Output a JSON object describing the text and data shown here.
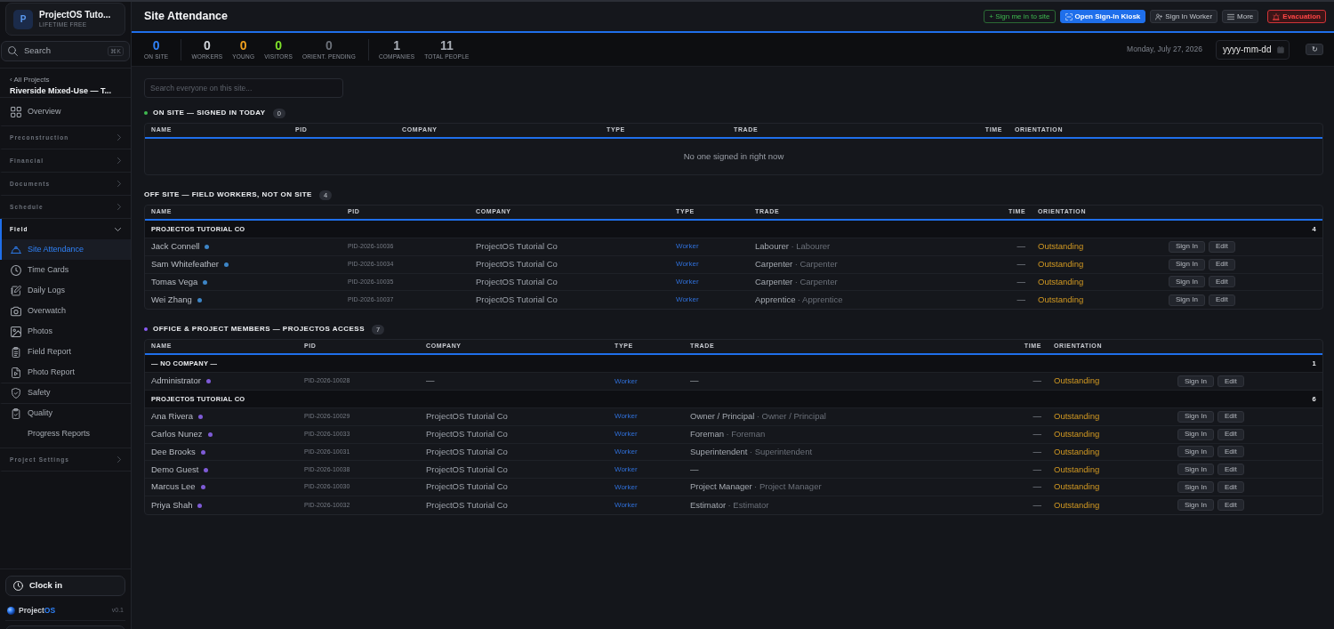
{
  "sidebar": {
    "workspace": {
      "initial": "P",
      "name": "ProjectOS Tuto...",
      "plan": "LIFETIME FREE"
    },
    "search": {
      "label": "Search",
      "shortcut": "⌘K"
    },
    "back_link": "‹ All Projects",
    "project": "Riverside Mixed-Use — T...",
    "nav": [
      {
        "kind": "link",
        "label": "Overview",
        "selected": false
      },
      {
        "kind": "section",
        "label": "Preconstruction",
        "expanded": false
      },
      {
        "kind": "section",
        "label": "Financial",
        "expanded": false
      },
      {
        "kind": "section",
        "label": "Documents",
        "expanded": false
      },
      {
        "kind": "section",
        "label": "Schedule",
        "expanded": false
      },
      {
        "kind": "section",
        "label": "Field",
        "expanded": true,
        "children": [
          {
            "label": "Site Attendance",
            "selected": true,
            "divider_above": false
          },
          {
            "label": "Time Cards",
            "selected": false,
            "divider_above": false
          },
          {
            "label": "Daily Logs",
            "selected": false,
            "divider_above": false
          },
          {
            "label": "Overwatch",
            "selected": false,
            "divider_above": false
          },
          {
            "label": "Photos",
            "selected": false,
            "divider_above": false
          },
          {
            "label": "Field Report",
            "selected": false,
            "divider_above": false
          },
          {
            "label": "Photo Report",
            "selected": false,
            "divider_above": false
          },
          {
            "label": "Safety",
            "selected": false,
            "divider_above": true
          },
          {
            "label": "Quality",
            "selected": false,
            "divider_above": true
          },
          {
            "label": "Progress Reports",
            "selected": false,
            "divider_above": false
          }
        ]
      },
      {
        "kind": "section",
        "label": "Project Settings",
        "expanded": false
      }
    ],
    "clock_in": "Clock in",
    "brand": {
      "name": "Project",
      "accent": "OS"
    },
    "version": "v0.1"
  },
  "page": {
    "title": "Site Attendance",
    "actions": [
      {
        "label": "+ Sign me in to site",
        "kind": "success"
      },
      {
        "label": "Open Sign-In Kiosk",
        "kind": "primary"
      },
      {
        "label": "Sign In Worker",
        "kind": "secondary"
      },
      {
        "label": "More",
        "kind": "secondary"
      },
      {
        "label": "Evacuation",
        "kind": "danger"
      }
    ]
  },
  "stat_groups": [
    {
      "items": [
        {
          "value": "0",
          "label": "ON SITE",
          "color": "#2f81f7"
        }
      ]
    },
    {
      "items": [
        {
          "value": "0",
          "label": "WORKERS",
          "color": "#d0d4da"
        },
        {
          "value": "0",
          "label": "YOUNG",
          "color": "#f0a01e"
        },
        {
          "value": "0",
          "label": "VISITORS",
          "color": "#7ee02a"
        },
        {
          "value": "0",
          "label": "ORIENT. PENDING",
          "color": "#6b7079"
        }
      ]
    },
    {
      "items": [
        {
          "value": "1",
          "label": "COMPANIES",
          "color": "#a8adb5"
        },
        {
          "value": "11",
          "label": "TOTAL PEOPLE",
          "color": "#a8adb5"
        }
      ]
    }
  ],
  "date": {
    "label": "Monday, July 27, 2026",
    "placeholder": "yyyy-mm-dd"
  },
  "refresh": "↻",
  "search": {
    "placeholder": "Search everyone on this site..."
  },
  "sections": [
    {
      "title": "ON SITE — SIGNED IN TODAY",
      "count": "0",
      "color": "#3fb950",
      "columns": [
        "NAME",
        "PID",
        "COMPANY",
        "TYPE",
        "TRADE",
        "TIME",
        "ORIENTATION"
      ],
      "empty_message": "No one signed in right now"
    },
    {
      "title": "OFF SITE — FIELD WORKERS, NOT ON SITE",
      "count": "4",
      "columns": [
        "NAME",
        "PID",
        "COMPANY",
        "TYPE",
        "TRADE",
        "TIME",
        "ORIENTATION"
      ],
      "groups": [
        {
          "name": "PROJECTOS TUTORIAL CO",
          "count": "4",
          "rows": [
            {
              "name": "Jack Connell",
              "color": "#3d85c6",
              "pid": "PID-2026-10036",
              "company": "ProjectOS Tutorial Co",
              "type": "Worker",
              "trade": "Labourer",
              "trade_secondary": "· Labourer",
              "time": "—",
              "orientation": "Outstanding",
              "actions": [
                "Sign In",
                "Edit"
              ]
            },
            {
              "name": "Sam Whitefeather",
              "color": "#3d85c6",
              "pid": "PID-2026-10034",
              "company": "ProjectOS Tutorial Co",
              "type": "Worker",
              "trade": "Carpenter",
              "trade_secondary": "· Carpenter",
              "time": "—",
              "orientation": "Outstanding",
              "actions": [
                "Sign In",
                "Edit"
              ]
            },
            {
              "name": "Tomas Vega",
              "color": "#3d85c6",
              "pid": "PID-2026-10035",
              "company": "ProjectOS Tutorial Co",
              "type": "Worker",
              "trade": "Carpenter",
              "trade_secondary": "· Carpenter",
              "time": "—",
              "orientation": "Outstanding",
              "actions": [
                "Sign In",
                "Edit"
              ]
            },
            {
              "name": "Wei Zhang",
              "color": "#3d85c6",
              "pid": "PID-2026-10037",
              "company": "ProjectOS Tutorial Co",
              "type": "Worker",
              "trade": "Apprentice",
              "trade_secondary": "· Apprentice",
              "time": "—",
              "orientation": "Outstanding",
              "actions": [
                "Sign In",
                "Edit"
              ]
            }
          ]
        }
      ]
    },
    {
      "title": "OFFICE & PROJECT MEMBERS — PROJECTOS ACCESS",
      "count": "7",
      "color": "#8b5cf6",
      "columns": [
        "NAME",
        "PID",
        "COMPANY",
        "TYPE",
        "TRADE",
        "TIME",
        "ORIENTATION"
      ],
      "groups": [
        {
          "name": "— NO COMPANY —",
          "count": "1",
          "rows": [
            {
              "name": "Administrator",
              "color": "#7e5bd6",
              "pid": "PID-2026-10028",
              "company": "—",
              "type": "Worker",
              "trade": "—",
              "time": "—",
              "orientation": "Outstanding",
              "actions": [
                "Sign In",
                "Edit"
              ]
            }
          ]
        },
        {
          "name": "PROJECTOS TUTORIAL CO",
          "count": "6",
          "rows": [
            {
              "name": "Ana Rivera",
              "color": "#7e5bd6",
              "pid": "PID-2026-10029",
              "company": "ProjectOS Tutorial Co",
              "type": "Worker",
              "trade": "Owner / Principal",
              "trade_secondary": "· Owner / Principal",
              "time": "—",
              "orientation": "Outstanding",
              "actions": [
                "Sign In",
                "Edit"
              ]
            },
            {
              "name": "Carlos Nunez",
              "color": "#7e5bd6",
              "pid": "PID-2026-10033",
              "company": "ProjectOS Tutorial Co",
              "type": "Worker",
              "trade": "Foreman",
              "trade_secondary": "· Foreman",
              "time": "—",
              "orientation": "Outstanding",
              "actions": [
                "Sign In",
                "Edit"
              ]
            },
            {
              "name": "Dee Brooks",
              "color": "#7e5bd6",
              "pid": "PID-2026-10031",
              "company": "ProjectOS Tutorial Co",
              "type": "Worker",
              "trade": "Superintendent",
              "trade_secondary": "· Superintendent",
              "time": "—",
              "orientation": "Outstanding",
              "actions": [
                "Sign In",
                "Edit"
              ]
            },
            {
              "name": "Demo Guest",
              "color": "#7e5bd6",
              "pid": "PID-2026-10038",
              "company": "ProjectOS Tutorial Co",
              "type": "Worker",
              "trade": "—",
              "time": "—",
              "orientation": "Outstanding",
              "actions": [
                "Sign In",
                "Edit"
              ]
            },
            {
              "name": "Marcus Lee",
              "color": "#7e5bd6",
              "pid": "PID-2026-10030",
              "company": "ProjectOS Tutorial Co",
              "type": "Worker",
              "trade": "Project Manager",
              "trade_secondary": "· Project Manager",
              "time": "—",
              "orientation": "Outstanding",
              "actions": [
                "Sign In",
                "Edit"
              ]
            },
            {
              "name": "Priya Shah",
              "color": "#7e5bd6",
              "pid": "PID-2026-10032",
              "company": "ProjectOS Tutorial Co",
              "type": "Worker",
              "trade": "Estimator",
              "trade_secondary": "· Estimator",
              "time": "—",
              "orientation": "Outstanding",
              "actions": [
                "Sign In",
                "Edit"
              ]
            }
          ]
        }
      ]
    }
  ]
}
